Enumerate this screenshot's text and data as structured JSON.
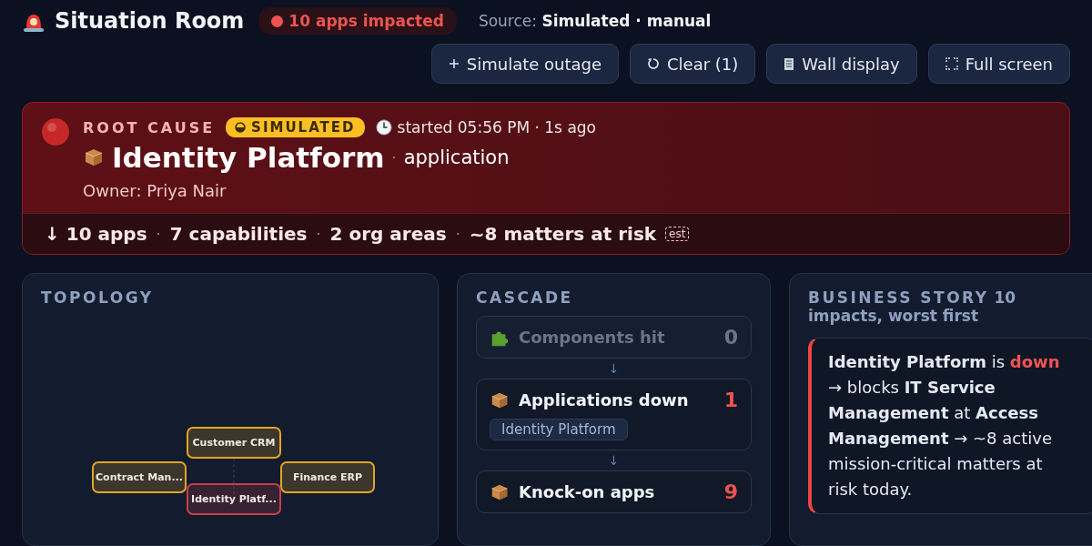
{
  "header": {
    "title": "Situation Room",
    "impact_badge": "10 apps impacted",
    "source_label": "Source:",
    "source_value": "Simulated · manual"
  },
  "actions": [
    {
      "kind": "add",
      "label": "Simulate outage"
    },
    {
      "kind": "clear",
      "label": "Clear (1)"
    },
    {
      "kind": "wall",
      "label": "Wall display"
    },
    {
      "kind": "full",
      "label": "Full screen"
    }
  ],
  "root_cause": {
    "label": "ROOT CAUSE",
    "badge": "SIMULATED",
    "started": "started 05:56 PM · 1s ago",
    "name": "Identity Platform",
    "type_separator": "·",
    "type": "application",
    "stat_separator": "·",
    "owner": "Owner: Priya Nair",
    "stats": [
      {
        "text": "↓ 10 apps"
      },
      {
        "text": "7 capabilities"
      },
      {
        "text": "2 org areas"
      },
      {
        "text": "~8 matters at risk",
        "tag": "est"
      }
    ]
  },
  "topology": {
    "title": "TOPOLOGY",
    "nodes": [
      {
        "label": "Customer CRM",
        "color": "#e0a526"
      },
      {
        "label": "Contract Man...",
        "color": "#e0a526"
      },
      {
        "label": "Finance ERP",
        "color": "#e0a526"
      },
      {
        "label": "Identity Platf...",
        "color": "#c2414b"
      }
    ]
  },
  "cascade": {
    "title": "CASCADE",
    "arrow": "↓",
    "steps": [
      {
        "kind": "component",
        "label": "Components hit",
        "count": "0",
        "disabled": true
      },
      {
        "kind": "app",
        "label": "Applications down",
        "count": "1",
        "disabled": false,
        "chips": [
          "Identity Platform"
        ]
      },
      {
        "kind": "app",
        "label": "Knock-on apps",
        "count": "9",
        "disabled": false
      }
    ]
  },
  "story": {
    "title": "BUSINESS STORY",
    "count": "10",
    "subtitle": "impacts, worst first",
    "items": [
      {
        "parts": [
          {
            "kind": "bold",
            "text": "Identity Platform"
          },
          {
            "kind": "plain",
            "text": " is "
          },
          {
            "kind": "alert",
            "text": "down"
          },
          {
            "kind": "plain",
            "text": " → blocks "
          },
          {
            "kind": "bold",
            "text": "IT Service Management"
          },
          {
            "kind": "plain",
            "text": " at "
          },
          {
            "kind": "bold",
            "text": "Access Management"
          },
          {
            "kind": "plain",
            "text": " → ~8 active mission-critical matters at risk today."
          }
        ]
      }
    ]
  }
}
